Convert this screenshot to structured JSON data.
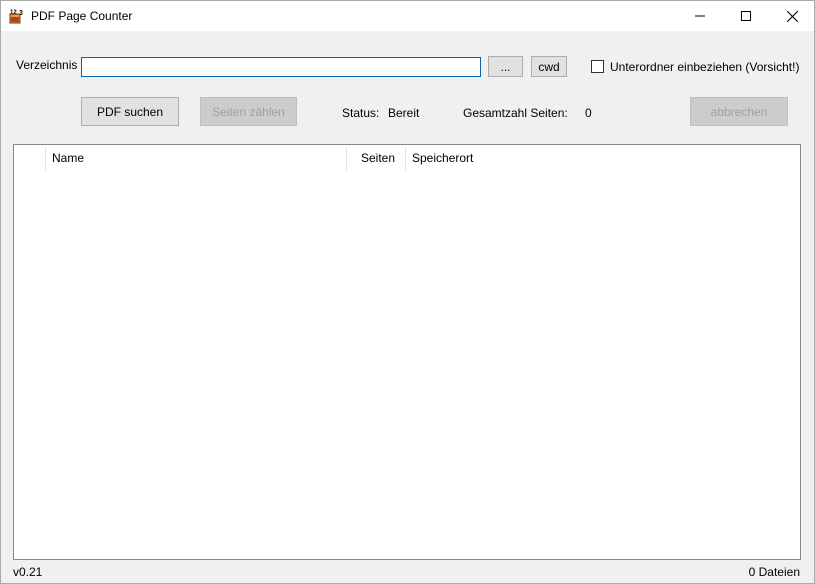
{
  "window": {
    "title": "PDF Page Counter",
    "controls": [
      "minimize",
      "maximize",
      "close"
    ]
  },
  "directory": {
    "label": "Verzeichnis",
    "value": "",
    "browse_label": "...",
    "cwd_label": "cwd"
  },
  "subfolders": {
    "label": "Unterordner einbeziehen (Vorsicht!)",
    "checked": false
  },
  "actions": {
    "search_label": "PDF suchen",
    "count_label": "Seiten zählen",
    "cancel_label": "abbrechen"
  },
  "status": {
    "label": "Status:",
    "value": "Bereit",
    "total_label": "Gesamtzahl Seiten:",
    "total_value": "0"
  },
  "table": {
    "columns": [
      "Name",
      "Seiten",
      "Speicherort"
    ],
    "rows": []
  },
  "footer": {
    "version": "v0.21",
    "file_count": "0 Dateien"
  },
  "colors": {
    "input_border": "#0a64ad",
    "window_bg": "#f0f0f0"
  }
}
